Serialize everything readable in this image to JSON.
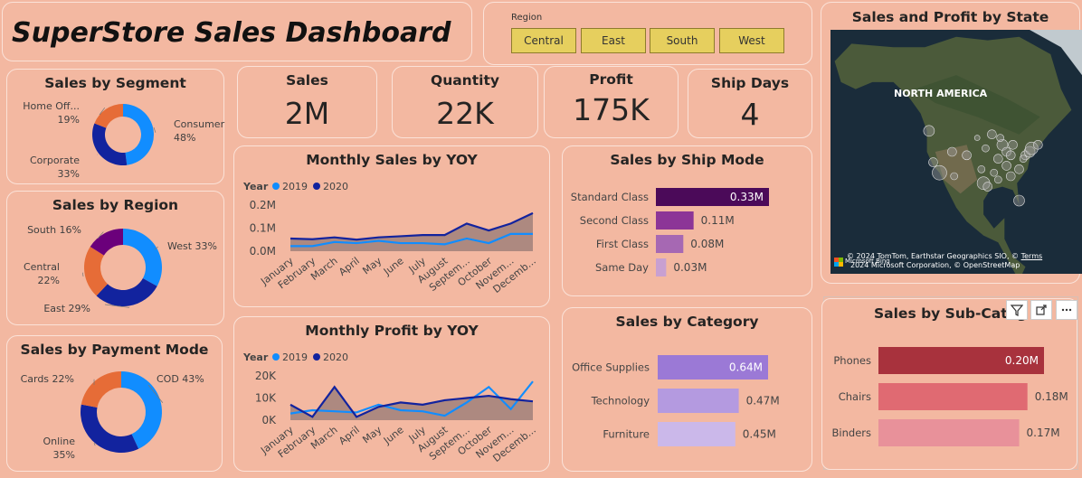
{
  "header": {
    "title": "SuperStore Sales Dashboard"
  },
  "slicer": {
    "label": "Region",
    "options": [
      "Central",
      "East",
      "South",
      "West"
    ]
  },
  "kpis": [
    {
      "title": "Sales",
      "value": "2M"
    },
    {
      "title": "Quantity",
      "value": "22K"
    },
    {
      "title": "Profit",
      "value": "175K"
    },
    {
      "title": "Ship Days",
      "value": "4"
    }
  ],
  "colors": {
    "background": "#f3b8a1",
    "year2019": "#118dff",
    "year2020": "#12239e",
    "donut_light": "#118dff",
    "donut_dark": "#12239e",
    "donut_orange": "#e66c37",
    "donut_purple": "#6b007b",
    "area_fill": "#a0807a"
  },
  "legend": {
    "title": "Year",
    "y2019": "2019",
    "y2020": "2020"
  },
  "chart_data": [
    {
      "id": "segment",
      "type": "pie",
      "title": "Sales by Segment",
      "slices": [
        {
          "label": "Consumer",
          "pct_label": "48%",
          "value": 48,
          "color": "#118dff"
        },
        {
          "label": "Corporate",
          "pct_label": "33%",
          "value": 33,
          "color": "#12239e"
        },
        {
          "label": "Home Off...",
          "pct_label": "19%",
          "value": 19,
          "color": "#e66c37"
        }
      ]
    },
    {
      "id": "region",
      "type": "pie",
      "title": "Sales by Region",
      "slices": [
        {
          "label": "West 33%",
          "value": 33,
          "color": "#118dff"
        },
        {
          "label": "East 29%",
          "value": 29,
          "color": "#12239e"
        },
        {
          "label": "Central",
          "pct_label": "22%",
          "value": 22,
          "color": "#e66c37"
        },
        {
          "label": "South 16%",
          "value": 16,
          "color": "#6b007b"
        }
      ]
    },
    {
      "id": "payment",
      "type": "pie",
      "title": "Sales by Payment Mode",
      "slices": [
        {
          "label": "COD 43%",
          "value": 43,
          "color": "#118dff"
        },
        {
          "label": "Online",
          "pct_label": "35%",
          "value": 35,
          "color": "#12239e"
        },
        {
          "label": "Cards 22%",
          "value": 22,
          "color": "#e66c37"
        }
      ]
    },
    {
      "id": "monthly_sales",
      "type": "area",
      "title": "Monthly Sales by YOY",
      "categories": [
        "January",
        "February",
        "March",
        "April",
        "May",
        "June",
        "July",
        "August",
        "Septem...",
        "October",
        "Novem...",
        "Decemb..."
      ],
      "yticks": [
        "0.0M",
        "0.1M",
        "0.2M"
      ],
      "ylim": [
        0,
        0.2
      ],
      "series": [
        {
          "name": "2019",
          "values": [
            0.022,
            0.022,
            0.04,
            0.035,
            0.045,
            0.035,
            0.035,
            0.03,
            0.055,
            0.035,
            0.075,
            0.075
          ]
        },
        {
          "name": "2020",
          "values": [
            0.055,
            0.052,
            0.06,
            0.05,
            0.06,
            0.065,
            0.07,
            0.07,
            0.12,
            0.09,
            0.12,
            0.165
          ]
        }
      ]
    },
    {
      "id": "monthly_profit",
      "type": "area",
      "title": "Monthly Profit by YOY",
      "categories": [
        "January",
        "February",
        "March",
        "April",
        "May",
        "June",
        "July",
        "August",
        "Septem...",
        "October",
        "Novem...",
        "Decemb..."
      ],
      "yticks": [
        "0K",
        "10K",
        "20K"
      ],
      "ylim": [
        0,
        20000
      ],
      "series": [
        {
          "name": "2019",
          "values": [
            3000,
            4500,
            4000,
            3500,
            7000,
            4500,
            4000,
            2000,
            8000,
            15000,
            5000,
            17500
          ]
        },
        {
          "name": "2020",
          "values": [
            7000,
            1500,
            15000,
            1500,
            6000,
            8000,
            7000,
            9000,
            10000,
            11000,
            9500,
            8500
          ]
        }
      ]
    },
    {
      "id": "ship_mode",
      "type": "bar",
      "title": "Sales by Ship Mode",
      "categories": [
        "Standard Class",
        "Second Class",
        "First Class",
        "Same Day"
      ],
      "values": [
        0.33,
        0.11,
        0.08,
        0.03
      ],
      "labels": [
        "0.33M",
        "0.11M",
        "0.08M",
        "0.03M"
      ],
      "colors": [
        "#4b0a59",
        "#8c3597",
        "#a668b3",
        "#c8a0d1"
      ]
    },
    {
      "id": "category",
      "type": "bar",
      "title": "Sales by Category",
      "categories": [
        "Office Supplies",
        "Technology",
        "Furniture"
      ],
      "values": [
        0.64,
        0.47,
        0.45
      ],
      "labels": [
        "0.64M",
        "0.47M",
        "0.45M"
      ],
      "colors": [
        "#9b79d6",
        "#b49ae0",
        "#cbb8ea"
      ]
    },
    {
      "id": "sub_category",
      "type": "bar",
      "title": "Sales by Sub-Categ",
      "categories": [
        "Phones",
        "Chairs",
        "Binders"
      ],
      "values": [
        0.2,
        0.18,
        0.17
      ],
      "labels": [
        "0.20M",
        "0.18M",
        "0.17M"
      ],
      "colors": [
        "#a8323d",
        "#e06a72",
        "#e8919a"
      ]
    }
  ],
  "map": {
    "title": "Sales and Profit by State",
    "label": "NORTH AMERICA",
    "attribution1": "© 2024 TomTom, Earthstar Geographics SIO, ©",
    "attribution_terms": "Terms",
    "attribution2": "2024 Microsoft Corporation, © OpenStreetMap",
    "brand": "Microsoft Bing",
    "bubbles": [
      [
        -123,
        46
      ],
      [
        -121,
        37
      ],
      [
        -118,
        34
      ],
      [
        -111,
        33
      ],
      [
        -112,
        40
      ],
      [
        -105,
        39
      ],
      [
        -97,
        31
      ],
      [
        -95,
        30
      ],
      [
        -98,
        35
      ],
      [
        -93,
        45
      ],
      [
        -88,
        42
      ],
      [
        -86,
        40
      ],
      [
        -83,
        42
      ],
      [
        -84,
        39
      ],
      [
        -77,
        39
      ],
      [
        -75,
        40
      ],
      [
        -74,
        41
      ],
      [
        -71,
        42
      ],
      [
        -80,
        26
      ],
      [
        -84,
        33
      ],
      [
        -86,
        36
      ],
      [
        -90,
        38
      ],
      [
        -90,
        32
      ],
      [
        -92,
        34
      ],
      [
        -96,
        41
      ],
      [
        -100,
        44
      ],
      [
        -80,
        35
      ],
      [
        -78,
        38
      ],
      [
        -89,
        44
      ]
    ],
    "bubble_sizes": [
      6,
      5,
      8,
      4,
      5,
      5,
      7,
      5,
      4,
      5,
      6,
      5,
      5,
      5,
      5,
      6,
      7,
      5,
      6,
      5,
      5,
      5,
      4,
      4,
      4,
      3,
      5,
      4,
      4
    ]
  },
  "toolbar": {
    "filter_icon": "filter-icon",
    "focus_icon": "focus-mode-icon",
    "more_icon": "more-options-icon"
  }
}
